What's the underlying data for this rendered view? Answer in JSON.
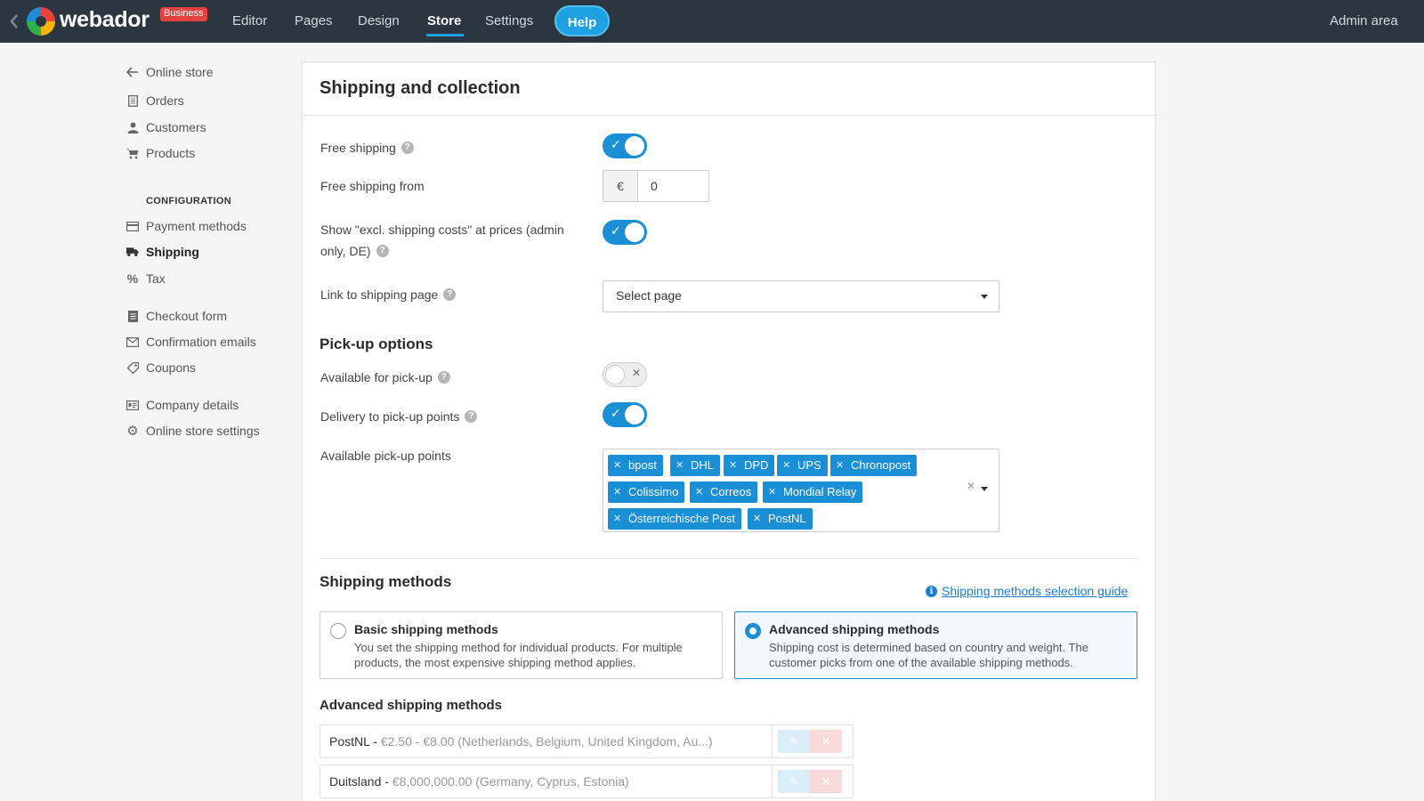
{
  "topbar": {
    "logo": "webador",
    "badge": "Business",
    "nav": [
      "Editor",
      "Pages",
      "Design",
      "Store",
      "Settings"
    ],
    "help": "Help",
    "admin": "Admin area"
  },
  "sidebar": {
    "group1": [
      "Online store",
      "Orders",
      "Customers",
      "Products"
    ],
    "config_heading": "CONFIGURATION",
    "group2": [
      "Payment methods",
      "Shipping",
      "Tax"
    ],
    "group3": [
      "Checkout form",
      "Confirmation emails",
      "Coupons"
    ],
    "group4": [
      "Company details",
      "Online store settings"
    ]
  },
  "panel": {
    "title": "Shipping and collection",
    "free_shipping": "Free shipping",
    "free_shipping_from": "Free shipping from",
    "currency": "€",
    "free_from_value": "0",
    "excl_line1": "Show \"excl. shipping costs\" at prices (admin",
    "excl_line2": "only, DE)",
    "link_page": "Link to shipping page",
    "select_page": "Select page",
    "pickup_heading": "Pick-up options",
    "available_pickup": "Available for pick-up",
    "delivery_points": "Delivery to pick-up points",
    "available_points": "Available pick-up points",
    "tags": [
      "bpost",
      "DHL",
      "DPD",
      "UPS",
      "Chronopost",
      "Colissimo",
      "Correos",
      "Mondial Relay",
      "Österreichische Post",
      "PostNL"
    ],
    "methods_heading": "Shipping methods",
    "guide": "Shipping methods selection guide",
    "basic_title": "Basic shipping methods",
    "basic_desc": "You set the shipping method for individual products. For multiple products, the most expensive shipping method applies.",
    "adv_title": "Advanced shipping methods",
    "adv_desc": "Shipping cost is determined based on country and weight. The customer picks from one of the available shipping methods.",
    "adv_heading": "Advanced shipping methods",
    "rows": [
      {
        "name": "PostNL",
        "detail": "€2.50 - €8.00 (Netherlands, Belgium, United Kingdom, Au...)"
      },
      {
        "name": "Duitsland",
        "detail": "€8,000,000.00 (Germany, Cyprus, Estonia)"
      }
    ]
  },
  "colors": {
    "accent": "#1a8fd6",
    "topbar": "#2b3640",
    "badge": "#e4423c"
  }
}
